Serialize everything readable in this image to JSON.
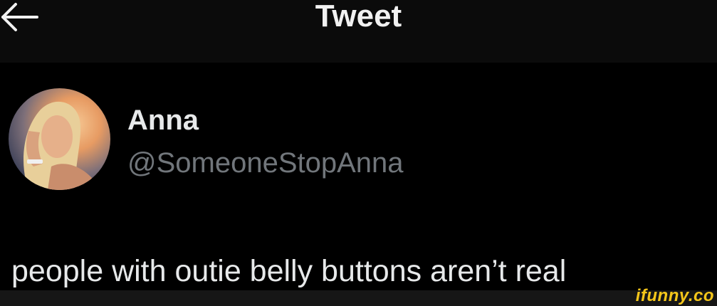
{
  "header": {
    "title": "Tweet",
    "back_icon": "arrow-left-icon"
  },
  "author": {
    "display_name": "Anna",
    "handle": "@SomeoneStopAnna",
    "avatar_icon": "profile-photo"
  },
  "tweet": {
    "text": "people with outie belly buttons aren’t real"
  },
  "watermark": {
    "text": "ifunny.co"
  },
  "colors": {
    "background": "#000000",
    "header_background": "#0b0b0b",
    "text_primary": "#e7e9ea",
    "text_secondary": "#71767b",
    "watermark": "#f5c61a"
  }
}
